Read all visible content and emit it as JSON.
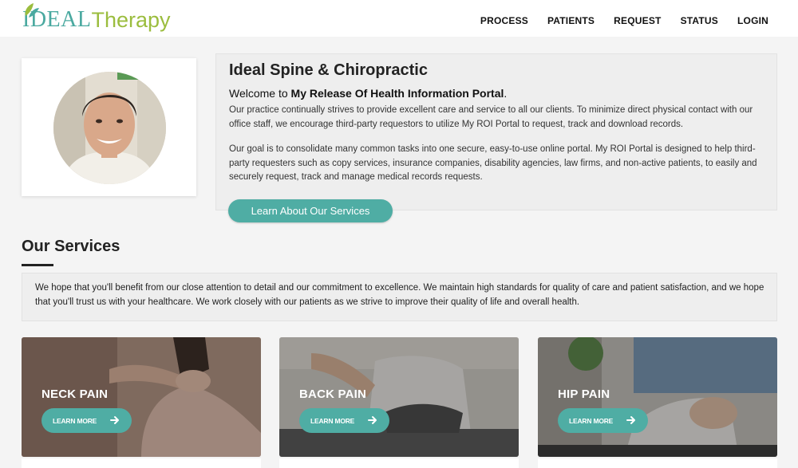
{
  "header": {
    "logo": {
      "part1": "IDEAL",
      "part2": "Therapy"
    },
    "nav": [
      "PROCESS",
      "PATIENTS",
      "REQUEST",
      "STATUS",
      "LOGIN"
    ]
  },
  "intro": {
    "title": "Ideal Spine & Chiropractic",
    "welcome_prefix": "Welcome to ",
    "welcome_bold": "My Release Of Health Information Portal",
    "welcome_suffix": ".",
    "paragraph1": "Our practice continually strives to provide excellent care and service to all our clients. To minimize direct physical contact with our office staff, we encourage third-party requestors to utilize My ROI Portal to request, track and download records.",
    "paragraph2": "Our goal is to consolidate many common tasks into one secure, easy-to-use online portal. My ROI Portal is designed to help third-party requesters such as copy services, insurance companies, disability agencies, law firms, and non-active patients, to easily and securely request, track and manage medical records requests.",
    "button_label": "Learn About Our Services"
  },
  "services": {
    "heading": "Our Services",
    "text": "We hope that you'll benefit from our close attention to detail and our commitment to excellence. We maintain high standards for quality of care and patient satisfaction, and we hope that you'll trust us with your healthcare. We work closely with our patients as we strive to improve their quality of life and overall health.",
    "cards": [
      {
        "title": "NECK PAIN",
        "button": "LEARN MORE"
      },
      {
        "title": "BACK PAIN",
        "button": "LEARN MORE"
      },
      {
        "title": "HIP PAIN",
        "button": "LEARN MORE"
      }
    ]
  },
  "colors": {
    "accent": "#4fada4",
    "logo_green": "#9bbd3e",
    "logo_teal": "#4aa9a0",
    "background": "#f4f4f4"
  }
}
